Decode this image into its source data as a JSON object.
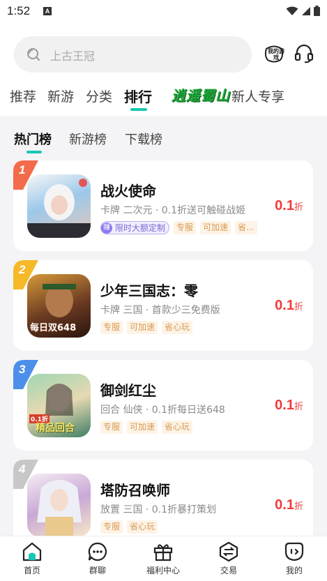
{
  "status_bar": {
    "time": "1:52",
    "notification_letter": "A"
  },
  "search": {
    "placeholder": "上古王冠"
  },
  "header_icons": {
    "my_games_label": "我的游戏"
  },
  "top_tabs": [
    {
      "label": "推荐",
      "active": false
    },
    {
      "label": "新游",
      "active": false
    },
    {
      "label": "分类",
      "active": false
    },
    {
      "label": "排行",
      "active": true
    },
    {
      "label": "逍遥蜀山",
      "active": false,
      "is_promo": true
    },
    {
      "label": "新人专享",
      "active": false
    }
  ],
  "sub_tabs": [
    {
      "label": "热门榜",
      "active": true
    },
    {
      "label": "新游榜",
      "active": false
    },
    {
      "label": "下载榜",
      "active": false
    }
  ],
  "games": [
    {
      "rank": "1",
      "rank_color": "#f36b4a",
      "name": "战火使命",
      "desc": "卡牌 二次元 · 0.1折送可触碰战姬",
      "promo_badge": "赚",
      "promo_tag": "限时大额定制",
      "tags": [
        "专服",
        "可加速",
        "省..."
      ],
      "discount": "0.1",
      "discount_unit": "折",
      "icon_colors": [
        "#6fb7e8",
        "#f2f2f2",
        "#d7b8a8"
      ]
    },
    {
      "rank": "2",
      "rank_color": "#f5b928",
      "name": "少年三国志：零",
      "desc": "卡牌 三国 · 首款少三免费版",
      "icon_text": "每日双648",
      "tags": [
        "专服",
        "可加速",
        "省心玩"
      ],
      "discount": "0.1",
      "discount_unit": "折",
      "icon_colors": [
        "#6b3a22",
        "#d89a3a",
        "#3a1f12"
      ]
    },
    {
      "rank": "3",
      "rank_color": "#4d8fe8",
      "name": "御剑红尘",
      "desc": "回合 仙侠 · 0.1折每日送648",
      "icon_text": "精品回合",
      "icon_badge": "0.1折",
      "tags": [
        "专服",
        "可加速",
        "省心玩"
      ],
      "discount": "0.1",
      "discount_unit": "折",
      "icon_colors": [
        "#7fc29b",
        "#e7d9b2",
        "#3f7d63"
      ]
    },
    {
      "rank": "4",
      "rank_color": "#c7c7c7",
      "name": "塔防召唤师",
      "desc": "放置 三国 · 0.1折暴打策划",
      "tags": [
        "专服",
        "省心玩"
      ],
      "discount": "0.1",
      "discount_unit": "折",
      "icon_colors": [
        "#e8d8e6",
        "#b58fc4",
        "#f6e7c8"
      ]
    }
  ],
  "bottom_nav": [
    {
      "label": "首页",
      "icon": "home-icon",
      "active": true
    },
    {
      "label": "群聊",
      "icon": "chat-icon",
      "active": false
    },
    {
      "label": "福利中心",
      "icon": "gift-icon",
      "active": false
    },
    {
      "label": "交易",
      "icon": "trade-icon",
      "active": false
    },
    {
      "label": "我的",
      "icon": "profile-icon",
      "active": false
    }
  ],
  "colors": {
    "accent": "#19c7b6",
    "discount": "#ef3b3b",
    "tag_text": "#d89b55",
    "tag_bg": "#fdf3e6"
  }
}
